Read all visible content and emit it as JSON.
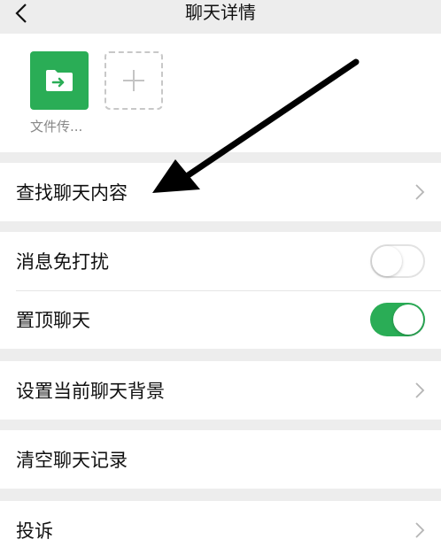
{
  "header": {
    "title": "聊天详情",
    "back_icon": "chevron-left-icon"
  },
  "members": {
    "items": [
      {
        "name": "文件传...",
        "icon": "file-transfer-icon",
        "color": "#2aad56"
      }
    ],
    "add_icon": "plus-icon"
  },
  "sections": {
    "search_history": {
      "label": "查找聊天内容"
    },
    "mute": {
      "label": "消息免打扰",
      "enabled": false
    },
    "sticky": {
      "label": "置顶聊天",
      "enabled": true
    },
    "background": {
      "label": "设置当前聊天背景"
    },
    "clear": {
      "label": "清空聊天记录"
    },
    "report": {
      "label": "投诉"
    }
  },
  "colors": {
    "accent": "#2aad56",
    "page_bg": "#ededed"
  },
  "annotation": {
    "icon": "arrow-icon",
    "points_to": "查找聊天内容"
  }
}
